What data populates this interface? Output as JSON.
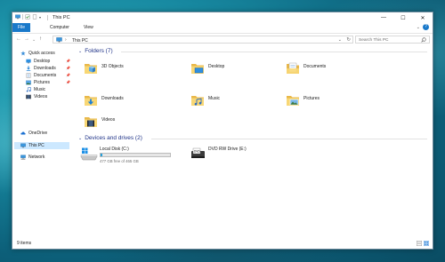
{
  "window": {
    "title": "This PC",
    "controls": [
      "—",
      "☐",
      "✕"
    ]
  },
  "ribbon": {
    "tabs": [
      "File",
      "Computer",
      "View"
    ],
    "collapse_glyph": "⌄",
    "help_glyph": "?"
  },
  "nav": {
    "back": "←",
    "forward": "→",
    "recent": "⌄",
    "up": "↑",
    "address_sep": "›",
    "address_text": "This PC",
    "address_dropdown": "⌄",
    "refresh": "↻",
    "search_placeholder": "Search This PC"
  },
  "sidebar": {
    "quick_access": "Quick access",
    "items": [
      {
        "label": "Desktop",
        "icon": "desktop-icon",
        "pinned": true
      },
      {
        "label": "Downloads",
        "icon": "downloads-icon",
        "pinned": true
      },
      {
        "label": "Documents",
        "icon": "documents-icon",
        "pinned": true
      },
      {
        "label": "Pictures",
        "icon": "pictures-icon",
        "pinned": true
      },
      {
        "label": "Music",
        "icon": "music-icon",
        "pinned": false
      },
      {
        "label": "Videos",
        "icon": "videos-icon",
        "pinned": false
      }
    ],
    "onedrive": "OneDrive",
    "this_pc": "This PC",
    "network": "Network"
  },
  "folders_group": {
    "header": "Folders (7)",
    "items": [
      {
        "label": "3D Objects",
        "icon": "3d-objects-folder-icon"
      },
      {
        "label": "Desktop",
        "icon": "desktop-folder-icon"
      },
      {
        "label": "Documents",
        "icon": "documents-folder-icon"
      },
      {
        "label": "Downloads",
        "icon": "downloads-folder-icon"
      },
      {
        "label": "Music",
        "icon": "music-folder-icon"
      },
      {
        "label": "Pictures",
        "icon": "pictures-folder-icon"
      },
      {
        "label": "Videos",
        "icon": "videos-folder-icon"
      }
    ]
  },
  "drives_group": {
    "header": "Devices and drives (2)",
    "local_disk": {
      "label": "Local Disk (C:)",
      "space": "477 GB free of 465 GB",
      "used_fraction": 0.03
    },
    "dvd": {
      "label": "DVD RW Drive (E:)"
    }
  },
  "status": {
    "item_count": "9 items"
  },
  "colors": {
    "accent": "#1979ca",
    "group_header": "#1e3287",
    "selection": "#cce8ff",
    "folder_yellow": "#f8d775"
  }
}
